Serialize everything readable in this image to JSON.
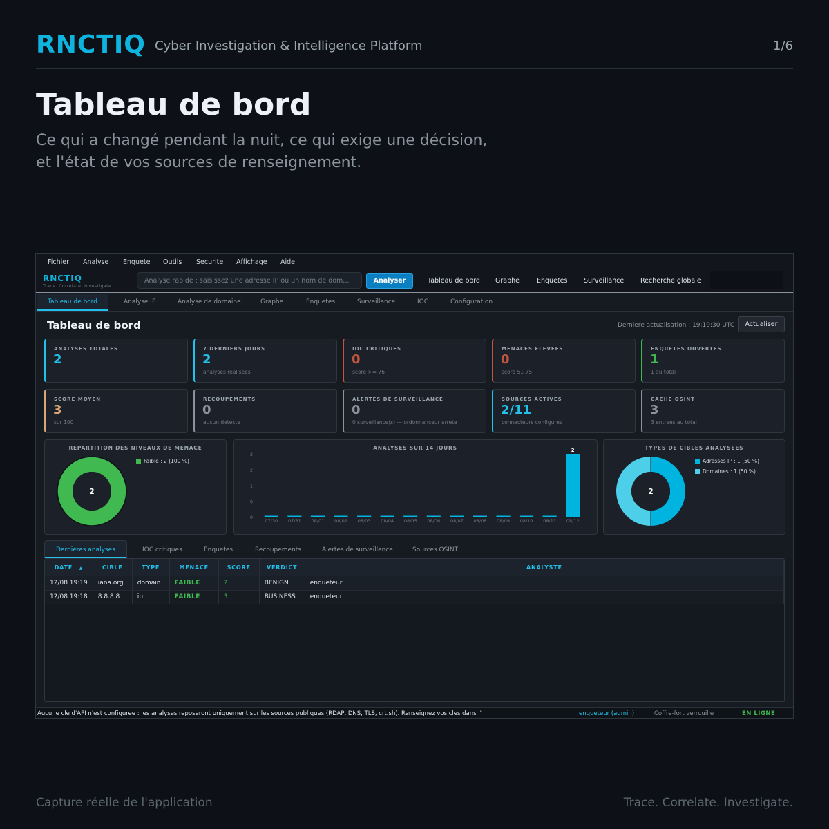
{
  "slide": {
    "brand": "RNCTIQ",
    "tagline": "Cyber Investigation & Intelligence Platform",
    "pager": "1/6",
    "title": "Tableau de bord",
    "subtitle_l1": "Ce qui a changé pendant la nuit, ce qui exige une décision,",
    "subtitle_l2": "et l'état de vos sources de renseignement.",
    "footer_left": "Capture réelle de l'application",
    "footer_right": "Trace. Correlate. Investigate."
  },
  "menubar": [
    "Fichier",
    "Analyse",
    "Enquete",
    "Outils",
    "Securite",
    "Affichage",
    "Aide"
  ],
  "toolbar": {
    "brand": "RNCTIQ",
    "tag": "Trace. Correlate. Investigate.",
    "search_placeholder": "Analyse rapide : saisissez une adresse IP ou un nom de dom...",
    "analyse_label": "Analyser",
    "links": [
      "Tableau de bord",
      "Graphe",
      "Enquetes",
      "Surveillance",
      "Recherche globale"
    ]
  },
  "tabs": [
    "Tableau de bord",
    "Analyse IP",
    "Analyse de domaine",
    "Graphe",
    "Enquetes",
    "Surveillance",
    "IOC",
    "Configuration"
  ],
  "dashboard": {
    "title": "Tableau de bord",
    "last_refresh": "Derniere actualisation : 19:19:30 UTC",
    "refresh_label": "Actualiser"
  },
  "cards": [
    {
      "label": "ANALYSES TOTALES",
      "value": "2",
      "hint": "",
      "color": "#22c0ea"
    },
    {
      "label": "7 DERNIERS JOURS",
      "value": "2",
      "hint": "analyses realisees",
      "color": "#22c0ea"
    },
    {
      "label": "IOC CRITIQUES",
      "value": "0",
      "hint": "score >= 76",
      "color": "#c0563f"
    },
    {
      "label": "MENACES ELEVEES",
      "value": "0",
      "hint": "score 51-75",
      "color": "#c0563f"
    },
    {
      "label": "ENQUETES OUVERTES",
      "value": "1",
      "hint": "1 au total",
      "color": "#3fb950"
    },
    {
      "label": "SCORE MOYEN",
      "value": "3",
      "hint": "sur 100",
      "color": "#d8a67a"
    },
    {
      "label": "RECOUPEMENTS",
      "value": "0",
      "hint": "aucun detecte",
      "color": "#8b949e"
    },
    {
      "label": "ALERTES DE SURVEILLANCE",
      "value": "0",
      "hint": "0 surveillance(s) — ordonnanceur arrete",
      "color": "#8b949e"
    },
    {
      "label": "SOURCES ACTIVES",
      "value": "2/11",
      "hint": "connecteurs configures",
      "color": "#22c0ea"
    },
    {
      "label": "CACHE OSINT",
      "value": "3",
      "hint": "3 entrees au total",
      "color": "#8b949e"
    }
  ],
  "threat_panel": {
    "title": "REPARTITION DES NIVEAUX DE MENACE",
    "center": "2",
    "legend": [
      "Faible : 2 (100 %)"
    ],
    "colors": [
      "#3fb950"
    ]
  },
  "chart_data": {
    "type": "bar",
    "title": "ANALYSES SUR 14 JOURS",
    "categories": [
      "07/30",
      "07/31",
      "08/01",
      "08/02",
      "08/03",
      "08/04",
      "08/05",
      "08/06",
      "08/07",
      "08/08",
      "08/09",
      "08/10",
      "08/11",
      "08/12"
    ],
    "values": [
      0,
      0,
      0,
      0,
      0,
      0,
      0,
      0,
      0,
      0,
      0,
      0,
      0,
      2
    ],
    "data_labels": [
      "",
      "",
      "",
      "",
      "",
      "",
      "",
      "",
      "",
      "",
      "",
      "",
      "",
      "2"
    ],
    "y_ticks": [
      "2",
      "2",
      "1",
      "0",
      "0"
    ],
    "ylim": [
      0,
      2
    ],
    "color": "#00b4e0",
    "grid": false
  },
  "targets_panel": {
    "title": "TYPES DE CIBLES ANALYSEES",
    "center": "2",
    "legend": [
      "Adresses IP : 1 (50 %)",
      "Domaines : 1 (50 %)"
    ],
    "colors": [
      "#00b4e0",
      "#4dcfea"
    ]
  },
  "bottom_tabs": [
    "Dernieres analyses",
    "IOC critiques",
    "Enquetes",
    "Recoupements",
    "Alertes de surveillance",
    "Sources OSINT"
  ],
  "table": {
    "headers": [
      "DATE",
      "CIBLE",
      "TYPE",
      "MENACE",
      "SCORE",
      "VERDICT",
      "ANALYSTE"
    ],
    "sort_indicator": "▲",
    "rows": [
      [
        "12/08 19:19",
        "iana.org",
        "domain",
        "FAIBLE",
        "2",
        "BENIGN",
        "enqueteur"
      ],
      [
        "12/08 19:18",
        "8.8.8.8",
        "ip",
        "FAIBLE",
        "3",
        "BUSINESS",
        "enqueteur"
      ]
    ],
    "menace_color": "#3fb950"
  },
  "statusbar": {
    "message": "Aucune cle d'API n'est configuree : les analyses reposeront uniquement sur les sources publiques (RDAP, DNS, TLS, crt.sh). Renseignez vos cles dans l'",
    "user": "enqueteur (admin)",
    "vault": "Coffre-fort verrouille",
    "state": "EN LIGNE"
  }
}
